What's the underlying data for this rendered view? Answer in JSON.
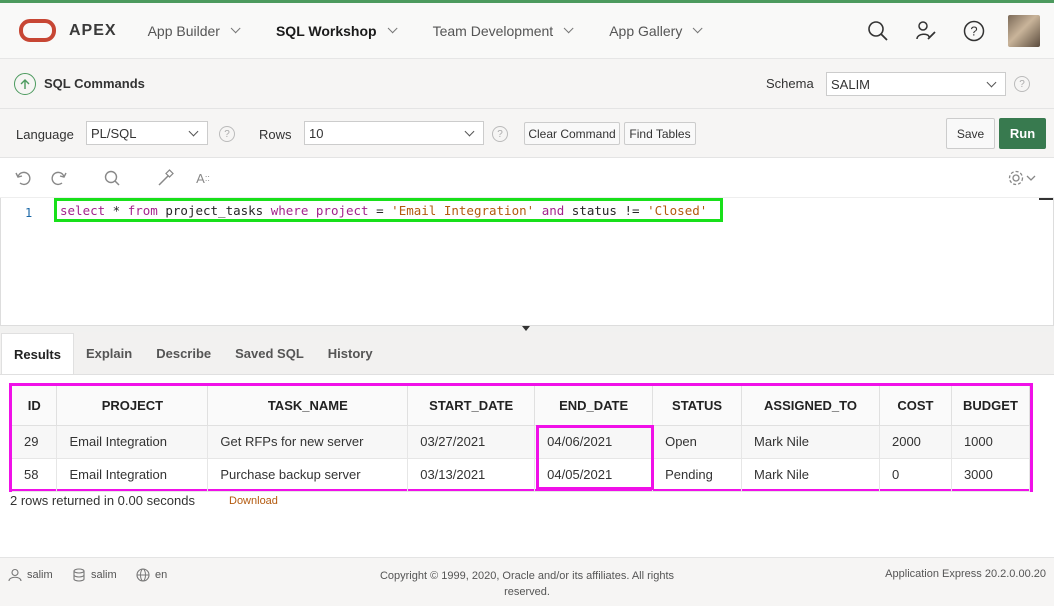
{
  "header": {
    "brand": "APEX",
    "nav": [
      {
        "label": "App Builder"
      },
      {
        "label": "SQL Workshop"
      },
      {
        "label": "Team Development"
      },
      {
        "label": "App Gallery"
      }
    ],
    "icons": [
      "search-icon",
      "admin-wrench-icon",
      "help-icon",
      "user-avatar"
    ]
  },
  "titlebar": {
    "title": "SQL Commands",
    "schema_label": "Schema",
    "schema_value": "SALIM"
  },
  "toolbar": {
    "language_label": "Language",
    "language_value": "PL/SQL",
    "rows_label": "Rows",
    "rows_value": "10",
    "clear_label": "Clear Command",
    "find_label": "Find Tables",
    "save_label": "Save",
    "run_label": "Run"
  },
  "editor": {
    "line_number": "1",
    "tokens": {
      "t1": "select",
      "t2": " * ",
      "t3": "from",
      "t4": " project_tasks ",
      "t5": "where",
      "t6": " ",
      "t7": "project",
      "t8": " = ",
      "t9": "'Email Integration'",
      "t10": " ",
      "t11": "and",
      "t12": " status != ",
      "t13": "'Closed'"
    }
  },
  "tabs": [
    {
      "label": "Results"
    },
    {
      "label": "Explain"
    },
    {
      "label": "Describe"
    },
    {
      "label": "Saved SQL"
    },
    {
      "label": "History"
    }
  ],
  "results": {
    "columns": [
      "ID",
      "PROJECT",
      "TASK_NAME",
      "START_DATE",
      "END_DATE",
      "STATUS",
      "ASSIGNED_TO",
      "COST",
      "BUDGET"
    ],
    "rows": [
      [
        "29",
        "Email Integration",
        "Get RFPs for new server",
        "03/27/2021",
        "04/06/2021",
        "Open",
        "Mark Nile",
        "2000",
        "1000"
      ],
      [
        "58",
        "Email Integration",
        "Purchase backup server",
        "03/13/2021",
        "04/05/2021",
        "Pending",
        "Mark Nile",
        "0",
        "3000"
      ]
    ],
    "summary": "2 rows returned in 0.00 seconds",
    "download_label": "Download"
  },
  "footer": {
    "user": "salim",
    "schema": "salim",
    "lang": "en",
    "copyright": "Copyright © 1999, 2020, Oracle and/or its affiliates. All rights reserved.",
    "version": "Application Express 20.2.0.00.20"
  },
  "colors": {
    "brand_red": "#c74634",
    "accent_green": "#387a4f",
    "highlight_green": "#18e01a",
    "highlight_magenta": "#f010e8"
  }
}
